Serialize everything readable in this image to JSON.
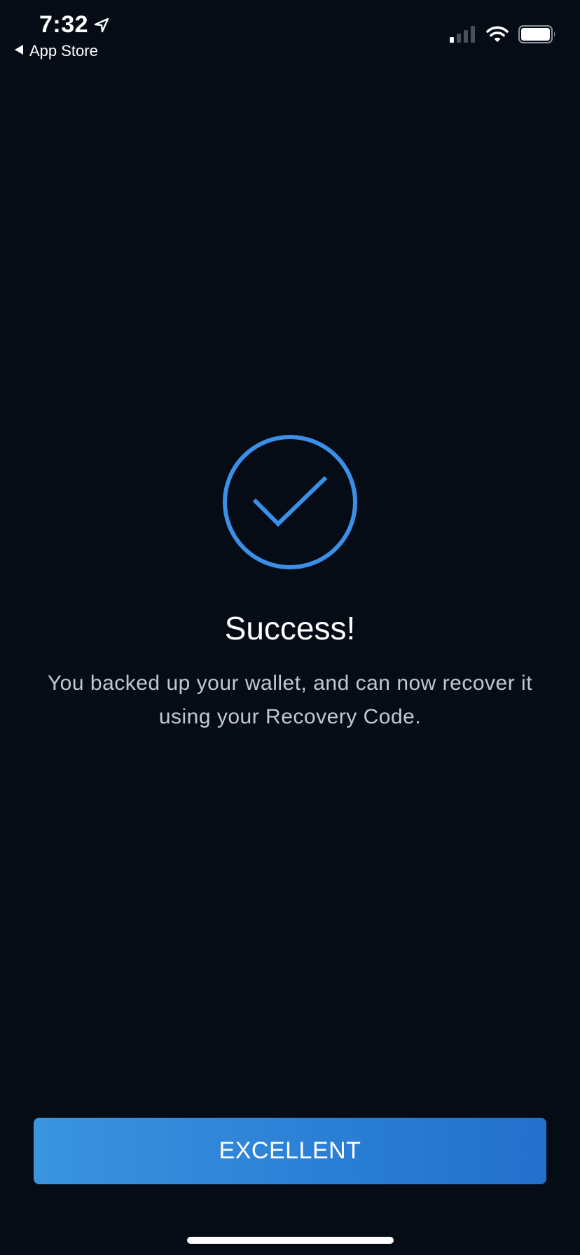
{
  "status_bar": {
    "time": "7:32",
    "back_label": "App Store",
    "icons": [
      "location-arrow-icon",
      "back-arrow-icon",
      "cellular-signal-icon",
      "wifi-icon",
      "battery-icon"
    ]
  },
  "success": {
    "icon": "check-circle-icon",
    "title": "Success!",
    "message": "You backed up your wallet, and can now recover it using your Recovery Code."
  },
  "actions": {
    "primary_label": "EXCELLENT"
  },
  "colors": {
    "background": "#060c16",
    "accent": "#3a8fe8",
    "button_start": "#3a94de",
    "button_end": "#2270cc",
    "message_text": "#c3c8d0"
  }
}
